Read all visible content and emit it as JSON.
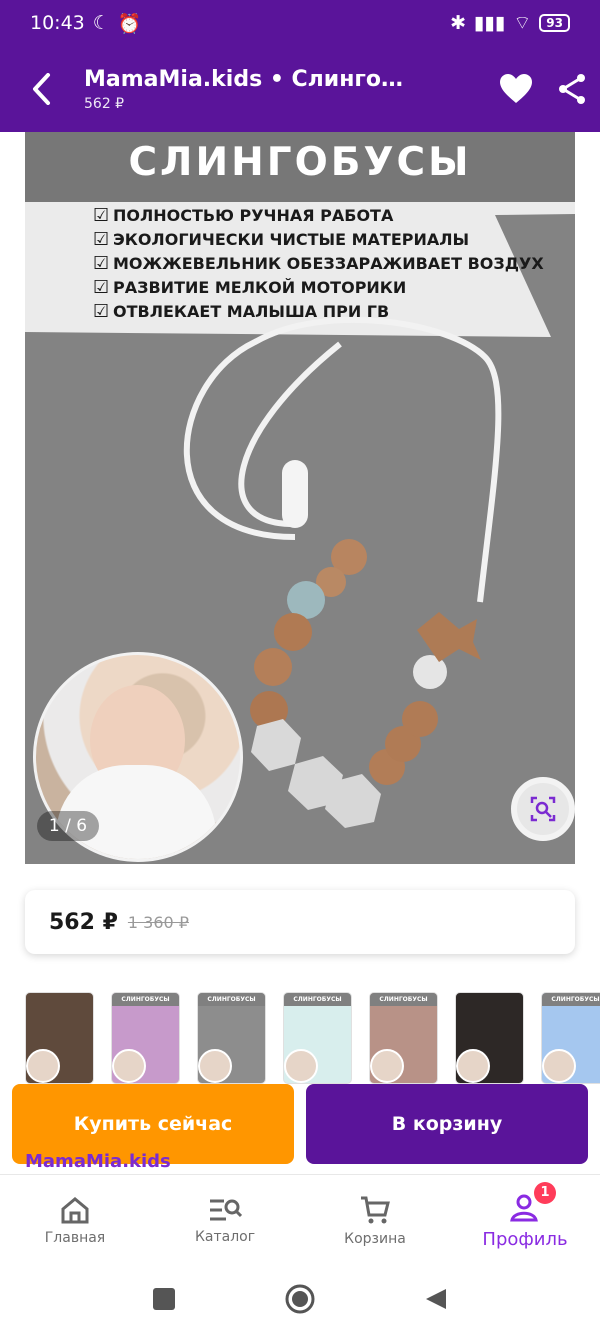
{
  "status_bar": {
    "time": "10:43",
    "battery": "93"
  },
  "header": {
    "title": "MamaMia.kids • Слингобусы",
    "price": "562 ₽"
  },
  "product_image": {
    "banner_title": "СЛИНГОБУСЫ",
    "features": [
      "ПОЛНОСТЬЮ РУЧНАЯ РАБОТА",
      "ЭКОЛОГИЧЕСКИ ЧИСТЫЕ МАТЕРИАЛЫ",
      "МОЖЖЕВЕЛЬНИК ОБЕЗЗАРАЖИВАЕТ ВОЗДУХ",
      "РАЗВИТИЕ МЕЛКОЙ МОТОРИКИ",
      "ОТВЛЕКАЕТ МАЛЫША ПРИ ГВ"
    ],
    "counter": "1 / 6"
  },
  "pricing": {
    "current": "562 ₽",
    "old": "1 360 ₽"
  },
  "thumbnails": [
    {
      "background": "#5f4a3c",
      "caption": ""
    },
    {
      "background": "#c79acb",
      "caption": "СЛИНГОБУСЫ"
    },
    {
      "background": "#8d8d8d",
      "caption": "СЛИНГОБУСЫ"
    },
    {
      "background": "#d8eeed",
      "caption": "СЛИНГОБУСЫ"
    },
    {
      "background": "#b89287",
      "caption": "СЛИНГОБУСЫ"
    },
    {
      "background": "#2d2826",
      "caption": ""
    },
    {
      "background": "#a5c7ef",
      "caption": "СЛИНГОБУСЫ"
    }
  ],
  "actions": {
    "buy_now": "Купить сейчас",
    "add_to_cart": "В корзину"
  },
  "seller": {
    "name": "MamaMia.kids"
  },
  "bottom_nav": {
    "home": "Главная",
    "catalog": "Каталог",
    "cart": "Корзина",
    "profile": "Профиль",
    "profile_badge": "1"
  }
}
